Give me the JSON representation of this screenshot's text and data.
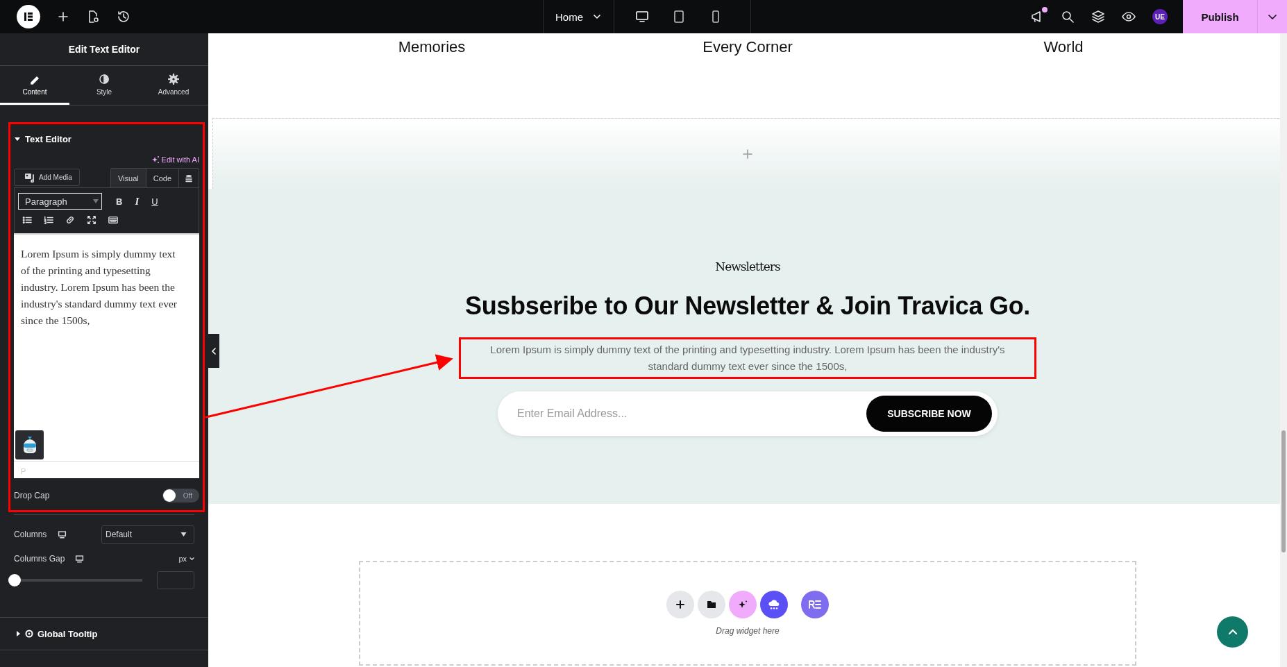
{
  "topbar": {
    "page": "Home",
    "avatar": "UE",
    "publish": "Publish",
    "notification": true,
    "devices": [
      {
        "kind": "desktop",
        "selected": true
      },
      {
        "kind": "tablet",
        "selected": false
      },
      {
        "kind": "mobile",
        "selected": false
      }
    ]
  },
  "panel": {
    "title": "Edit Text Editor",
    "tabs": [
      {
        "label": "Content",
        "kind": "pencil",
        "selected": true
      },
      {
        "label": "Style",
        "kind": "contrast",
        "selected": false
      },
      {
        "label": "Advanced",
        "kind": "gear",
        "selected": false
      }
    ],
    "section": {
      "title": "Text Editor",
      "expanded": true,
      "ai_link": "Edit with AI",
      "add_media": "Add Media",
      "modes": [
        {
          "label": "Visual",
          "selected": true
        },
        {
          "label": "Code",
          "selected": false
        }
      ],
      "format": "Paragraph",
      "format_buttons": [
        "B",
        "I",
        "U"
      ],
      "content": "Lorem Ipsum is simply dummy text of the printing and typesetting industry. Lorem Ipsum has been the industry's standard dummy text ever since the 1500s,",
      "path": "P"
    },
    "drop_cap": {
      "label": "Drop Cap",
      "on": false,
      "state_text": "Off"
    },
    "columns": {
      "label": "Columns",
      "value": "Default"
    },
    "columns_gap": {
      "label": "Columns Gap",
      "unit": "px",
      "level": 0
    },
    "collapsed_sections": [
      {
        "title": "Global Tooltip",
        "expanded": false
      }
    ]
  },
  "canvas": {
    "card_titles": [
      "Memories",
      "Every Corner",
      "World"
    ],
    "newsletter": {
      "eyebrow": "Newsletters",
      "heading": "Susbseribe to Our Newsletter & Join Travica Go.",
      "text": "Lorem Ipsum is simply dummy text of the printing and typesetting industry. Lorem Ipsum has been the industry's standard dummy text ever since the 1500s,",
      "email_placeholder": "Enter Email Address...",
      "button": "SUBSCRIBE NOW"
    },
    "drop_zone": {
      "hint": "Drag widget here"
    }
  }
}
